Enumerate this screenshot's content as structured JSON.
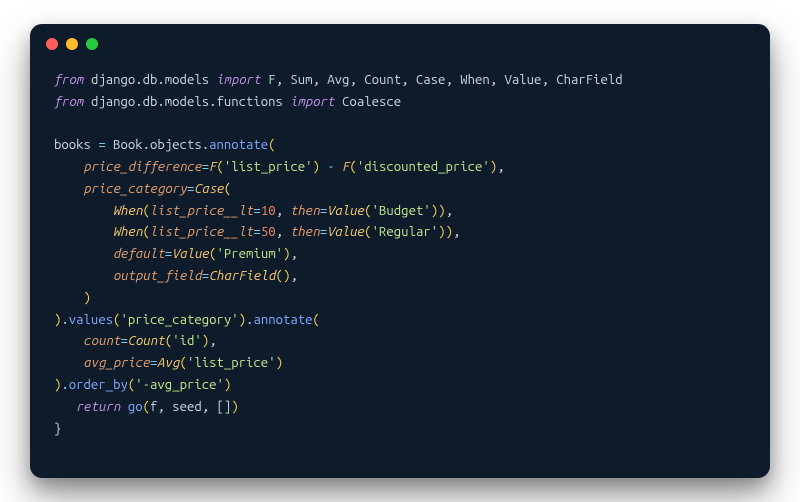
{
  "window": {
    "traffic_lights": [
      "close",
      "minimize",
      "zoom"
    ]
  },
  "code": {
    "l1": {
      "kw1": "from",
      "pkg": "django.db.models",
      "kw2": "import",
      "imports": "F, Sum, Avg, Count, Case, When, Value, CharField"
    },
    "l2": {
      "kw1": "from",
      "pkg": "django.db.models.functions",
      "kw2": "import",
      "imports": "Coalesce"
    },
    "l3": "",
    "l4": {
      "var": "books",
      "eq": " = ",
      "obj": "Book.objects",
      "dot": ".",
      "method": "annotate",
      "open": "("
    },
    "l5": {
      "indent": "    ",
      "param": "price_difference",
      "eq": "=",
      "fn1": "F",
      "p1": "(",
      "s1": "'list_price'",
      "p2": ")",
      "minus": " - ",
      "fn2": "F",
      "p3": "(",
      "s2": "'discounted_price'",
      "p4": ")",
      "comma": ","
    },
    "l6": {
      "indent": "    ",
      "param": "price_category",
      "eq": "=",
      "cls": "Case",
      "open": "("
    },
    "l7": {
      "indent": "        ",
      "cls": "When",
      "open": "(",
      "param": "list_price__lt",
      "eq": "=",
      "num": "10",
      "comma1": ", ",
      "param2": "then",
      "eq2": "=",
      "cls2": "Value",
      "open2": "(",
      "str": "'Budget'",
      "close2": ")",
      "close": ")",
      "comma2": ","
    },
    "l8": {
      "indent": "        ",
      "cls": "When",
      "open": "(",
      "param": "list_price__lt",
      "eq": "=",
      "num": "50",
      "comma1": ", ",
      "param2": "then",
      "eq2": "=",
      "cls2": "Value",
      "open2": "(",
      "str": "'Regular'",
      "close2": ")",
      "close": ")",
      "comma2": ","
    },
    "l9": {
      "indent": "        ",
      "param": "default",
      "eq": "=",
      "cls": "Value",
      "open": "(",
      "str": "'Premium'",
      "close": ")",
      "comma": ","
    },
    "l10": {
      "indent": "        ",
      "param": "output_field",
      "eq": "=",
      "cls": "CharField",
      "open": "(",
      "close": ")",
      "comma": ","
    },
    "l11": {
      "indent": "    ",
      "close": ")"
    },
    "l12": {
      "close1": ")",
      "dot1": ".",
      "m1": "values",
      "p1": "(",
      "s1": "'price_category'",
      "p2": ")",
      "dot2": ".",
      "m2": "annotate",
      "p3": "("
    },
    "l13": {
      "indent": "    ",
      "param": "count",
      "eq": "=",
      "cls": "Count",
      "open": "(",
      "str": "'id'",
      "close": ")",
      "comma": ","
    },
    "l14": {
      "indent": "    ",
      "param": "avg_price",
      "eq": "=",
      "cls": "Avg",
      "open": "(",
      "str": "'list_price'",
      "close": ")"
    },
    "l15": {
      "close": ")",
      "dot": ".",
      "m": "order_by",
      "p1": "(",
      "str": "'-avg_price'",
      "p2": ")"
    },
    "l16": {
      "indent": "   ",
      "kw": "return",
      "sp": " ",
      "fn": "go",
      "open": "(",
      "args": "f, seed, []",
      "close": ")"
    },
    "l17": {
      "brace": "}"
    }
  }
}
